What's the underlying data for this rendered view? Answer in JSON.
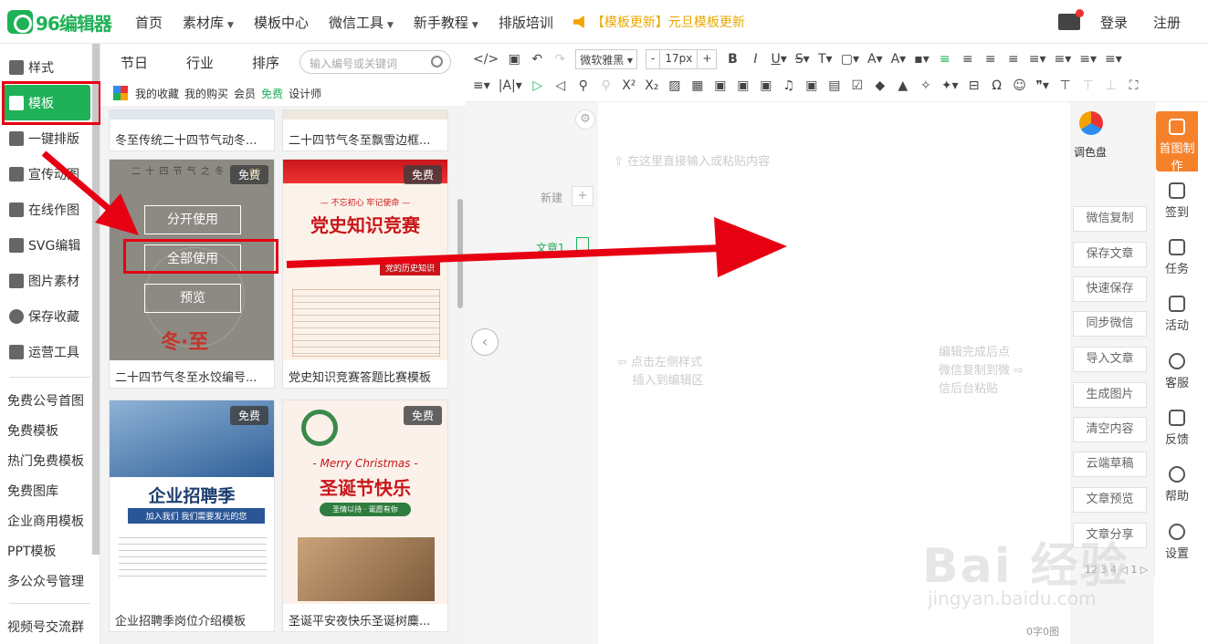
{
  "app": {
    "logo_text": "96编辑器"
  },
  "nav": {
    "items": [
      {
        "label": "首页",
        "caret": false
      },
      {
        "label": "素材库",
        "caret": true
      },
      {
        "label": "模板中心",
        "caret": false
      },
      {
        "label": "微信工具",
        "caret": true
      },
      {
        "label": "新手教程",
        "caret": true
      },
      {
        "label": "排版培训",
        "caret": false
      }
    ],
    "update": "【模板更新】元旦模板更新",
    "login": "登录",
    "register": "注册"
  },
  "sidebar": {
    "items": [
      {
        "label": "样式"
      },
      {
        "label": "模板"
      },
      {
        "label": "一键排版"
      },
      {
        "label": "宣传动图"
      },
      {
        "label": "在线作图"
      },
      {
        "label": "SVG编辑"
      },
      {
        "label": "图片素材"
      },
      {
        "label": "保存收藏"
      },
      {
        "label": "运营工具"
      }
    ],
    "links": [
      "免费公号首图",
      "免费模板",
      "热门免费模板",
      "免费图库",
      "企业商用模板",
      "PPT模板",
      "多公众号管理",
      "视频号交流群"
    ]
  },
  "panel": {
    "tabs": [
      "节日",
      "行业",
      "排序"
    ],
    "search_placeholder": "输入编号或关键词",
    "filters": [
      "我的收藏",
      "我的购买",
      "会员",
      "免费",
      "设计师"
    ],
    "cards": [
      {
        "caption": "冬至传统二十四节气动冬..."
      },
      {
        "caption": "二十四节气冬至飘雪边框..."
      },
      {
        "caption": "二十四节气冬至水饺编号...",
        "badge": "免费",
        "poster_title": "冬·至",
        "poster_top": "二 十 四 节 气 之 冬",
        "overlay": [
          "分开使用",
          "全部使用",
          "预览"
        ]
      },
      {
        "caption": "党史知识竞赛答题比赛模板",
        "badge": "免费",
        "poster_title": "党史知识竞赛",
        "poster_sub": "— 不忘初心 牢记使命 —",
        "poster_tag": "党的历史知识"
      },
      {
        "caption": "企业招聘季岗位介绍模板",
        "badge": "免费",
        "poster_title": "企业招聘季",
        "poster_sub": "加入我们 我们需要发光的您"
      },
      {
        "caption": "圣诞平安夜快乐圣诞树麋...",
        "badge": "免费",
        "poster_title": "圣诞节快乐",
        "poster_sub": "- Merry Christmas -",
        "poster_btn": "圣情以待 · 诞愿有你"
      }
    ]
  },
  "toolbar": {
    "font": "微软雅黑",
    "size": "17px",
    "minus": "-",
    "plus": "+"
  },
  "editor": {
    "new_label": "新建",
    "article_label": "文章1",
    "hint_top": "在这里直接输入或粘贴内容",
    "hint_left_1": "点击左侧样式",
    "hint_left_2": "插入到编辑区",
    "hint_right_1": "编辑完成后点",
    "hint_right_2": "微信复制到微",
    "hint_right_3": "信后台粘贴",
    "word_count": "0字0图"
  },
  "right": {
    "palette": "调色盘",
    "buttons": [
      "微信复制",
      "保存文章",
      "快速保存",
      "同步微信",
      "导入文章",
      "生成图片",
      "清空内容",
      "云端草稿",
      "文章预览",
      "文章分享"
    ],
    "footer_text": "1​2 3 4 ◁ 1 ▷"
  },
  "icon_bar": [
    "首图制作",
    "签到",
    "任务",
    "活动",
    "客服",
    "反馈",
    "帮助",
    "设置"
  ],
  "watermark": {
    "main": "Bai 经验",
    "sub": "jingyan.baidu.com"
  },
  "colors": {
    "brand": "#1fb157",
    "accent": "#f5812a",
    "annotation": "#e60012"
  }
}
